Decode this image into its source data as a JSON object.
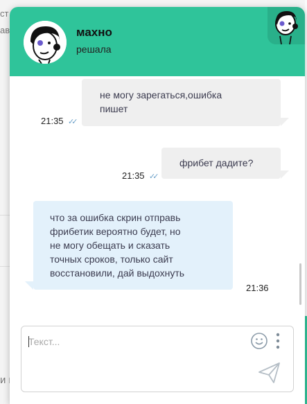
{
  "background": {
    "fragments": [
      "ст",
      "ав",
      "и к"
    ]
  },
  "header": {
    "agent_name": "махно",
    "agent_status": "решала",
    "accent_color": "#2fc49a",
    "avatar_icon": "face-avatar-icon"
  },
  "messages": [
    {
      "direction": "outgoing",
      "lines": [
        "не могу зарегаться,ошибка",
        "пишет"
      ],
      "time": "21:35",
      "status_icon": "double-check-icon"
    },
    {
      "direction": "outgoing",
      "lines": [
        "фрибет дадите?"
      ],
      "time": "21:35",
      "status_icon": "double-check-icon"
    },
    {
      "direction": "incoming",
      "lines": [
        "что за ошибка скрин отправь",
        "фрибетик вероятно будет, но",
        "не могу обещать и сказать",
        "точных сроков, только сайт",
        "восстановили, дай выдохнуть"
      ],
      "time": "21:36"
    }
  ],
  "composer": {
    "placeholder": "Текст...",
    "emoji_icon": "smiley-icon",
    "menu_icon": "more-vertical-icon",
    "send_icon": "send-icon"
  }
}
